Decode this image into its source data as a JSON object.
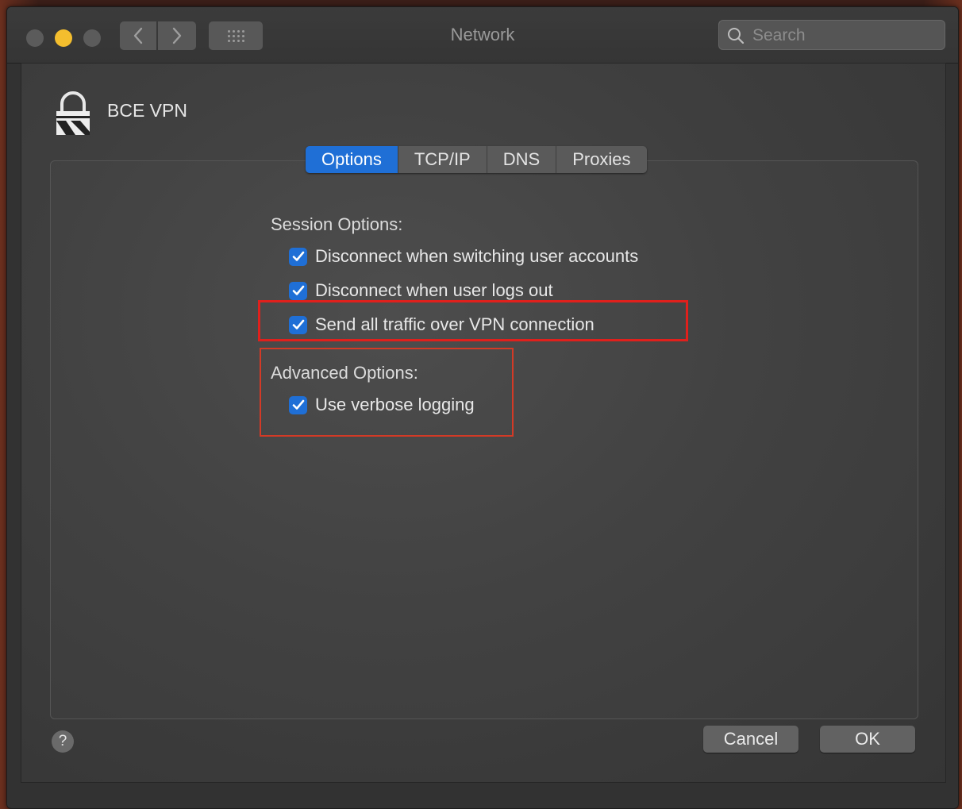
{
  "window": {
    "title": "Network"
  },
  "search": {
    "placeholder": "Search"
  },
  "service": {
    "name": "BCE VPN"
  },
  "tabs": [
    {
      "label": "Options",
      "active": true
    },
    {
      "label": "TCP/IP",
      "active": false
    },
    {
      "label": "DNS",
      "active": false
    },
    {
      "label": "Proxies",
      "active": false
    }
  ],
  "session": {
    "heading": "Session Options:",
    "options": [
      {
        "label": "Disconnect when switching user accounts",
        "checked": true
      },
      {
        "label": "Disconnect when user logs out",
        "checked": true
      },
      {
        "label": "Send all traffic over VPN connection",
        "checked": true
      }
    ]
  },
  "advanced": {
    "heading": "Advanced Options:",
    "options": [
      {
        "label": "Use verbose logging",
        "checked": true
      }
    ]
  },
  "footer": {
    "help": "?",
    "cancel": "Cancel",
    "ok": "OK"
  },
  "colors": {
    "accent": "#1f6fd6",
    "highlight": "#e0201c",
    "minimize": "#f4be2e"
  },
  "icons": [
    "lock-icon",
    "search-icon",
    "back-chevron-icon",
    "forward-chevron-icon",
    "grid-icon",
    "checkmark-icon"
  ]
}
